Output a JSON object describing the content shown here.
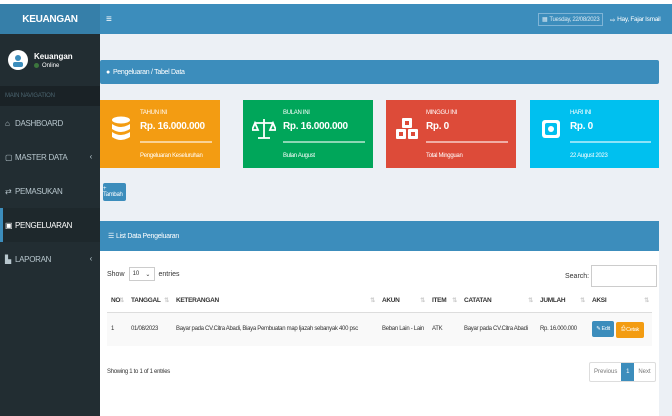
{
  "app": {
    "brand": "KEUANGAN"
  },
  "user": {
    "name": "Keuangan",
    "status": "Online"
  },
  "nav": {
    "header": "MAIN NAVIGATION",
    "items": [
      {
        "label": "DASHBOARD",
        "icon": "home-icon"
      },
      {
        "label": "MASTER DATA",
        "icon": "square-icon"
      },
      {
        "label": "PEMASUKAN",
        "icon": "exchange-icon"
      },
      {
        "label": "PENGELUARAN",
        "icon": "money-icon"
      },
      {
        "label": "LAPORAN",
        "icon": "file-icon"
      }
    ]
  },
  "header": {
    "date": "Tuesday, 22/08/2023",
    "greeting": "Hay, Fajar Ismail"
  },
  "breadcrumb": "Pengeluaran / Tabel Data",
  "infoboxes": [
    {
      "label": "TAHUN INI",
      "value": "Rp. 16.000.000",
      "sub": "Pengeluaran Keseluruhan",
      "color": "#f39c12",
      "icon": "database-icon"
    },
    {
      "label": "BULAN INI",
      "value": "Rp. 16.000.000",
      "sub": "Bulan August",
      "color": "#00a65a",
      "icon": "balance-scale-icon"
    },
    {
      "label": "MINGGU INI",
      "value": "Rp. 0",
      "sub": "Total Mingguan",
      "color": "#dd4b39",
      "icon": "cubes-icon"
    },
    {
      "label": "HARI INI",
      "value": "Rp. 0",
      "sub": "22 August 2023",
      "color": "#00c0ef",
      "icon": "money-icon"
    }
  ],
  "add_button": "+ Tambah",
  "panel": {
    "title": "List Data Pengeluaran",
    "show": "Show",
    "entries_value": "10",
    "entries": "entries",
    "search": "Search:",
    "columns": [
      "NO",
      "TANGGAL",
      "KETERANGAN",
      "AKUN",
      "ITEM",
      "CATATAN",
      "JUMLAH",
      "AKSI"
    ],
    "rows": [
      {
        "no": "1",
        "tanggal": "01/08/2023",
        "keterangan": "Bayar pada CV.Citra Abadi, Biaya Pembuatan map Ijazah sebanyak 400 psc",
        "akun": "Beban Lain - Lain",
        "item": "ATK",
        "catatan": "Bayar pada CV.Citra Abadi",
        "jumlah": "Rp. 16.000.000"
      }
    ],
    "edit_label": "Edit",
    "cetak_label": "Cetak",
    "showing": "Showing 1 to 1 of 1 entries",
    "pager": {
      "prev": "Previous",
      "current": "1",
      "next": "Next"
    }
  }
}
